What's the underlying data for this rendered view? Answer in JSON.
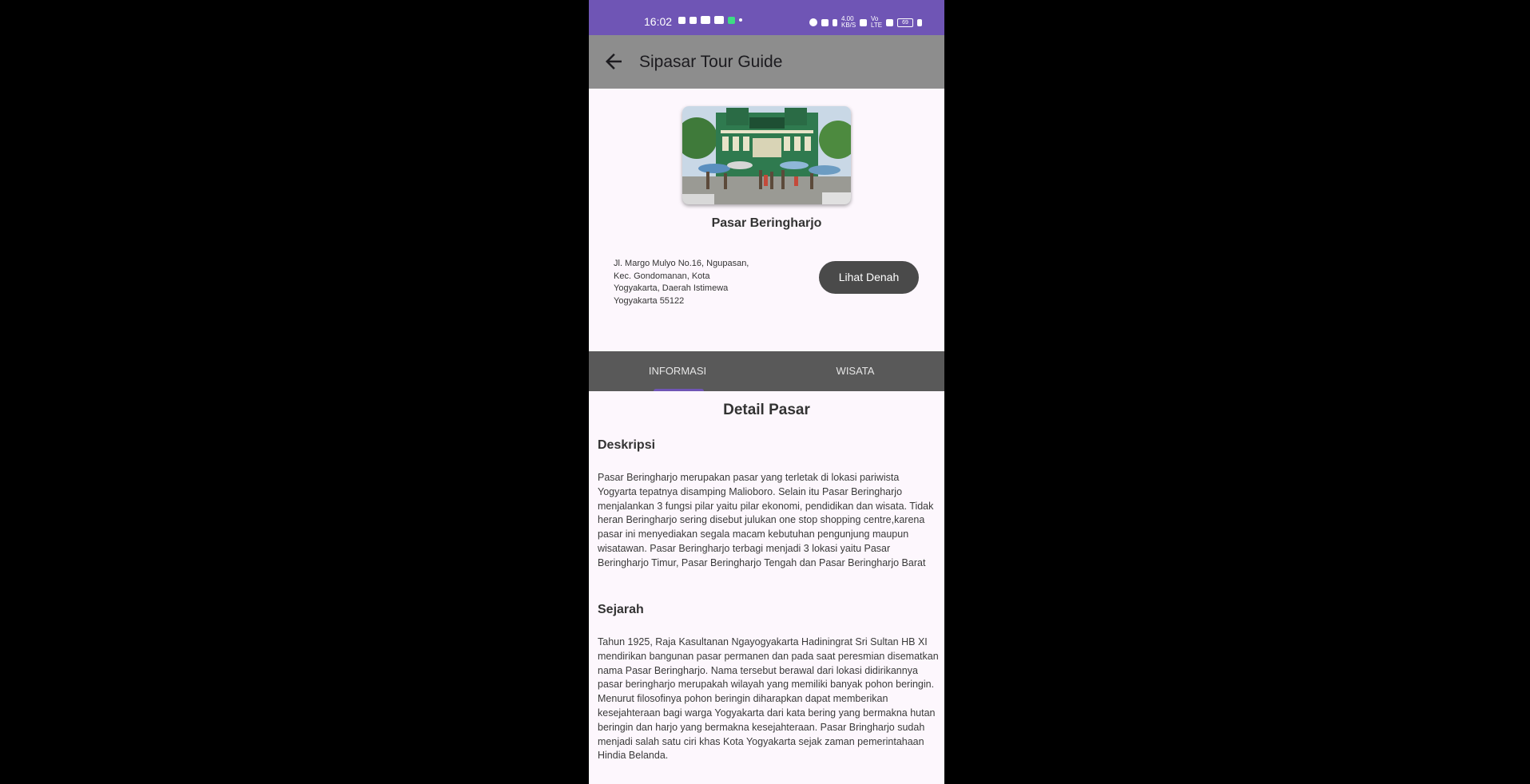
{
  "status_bar": {
    "time": "16:02",
    "network_speed": "4.00 KB/S",
    "network_type": "Vo LTE",
    "battery": "69"
  },
  "app_bar": {
    "title": "Sipasar Tour Guide",
    "back_icon": "arrow-back-icon"
  },
  "market": {
    "image_sign_text": "Pasar Beringharjo",
    "name": "Pasar Beringharjo",
    "address": "Jl. Margo Mulyo No.16, Ngupasan, Kec. Gondomanan, Kota Yogyakarta, Daerah Istimewa Yogyakarta 55122",
    "denah_button": "Lihat Denah"
  },
  "tabs": [
    {
      "label": "INFORMASI",
      "selected": true
    },
    {
      "label": "WISATA",
      "selected": false
    }
  ],
  "detail": {
    "title": "Detail Pasar",
    "sections": [
      {
        "heading": "Deskripsi",
        "body": "Pasar Beringharjo merupakan pasar yang terletak di lokasi pariwista Yogyarta tepatnya disamping Malioboro.  Selain itu Pasar Beringharjo menjalankan 3 fungsi pilar yaitu pilar ekonomi, pendidikan dan wisata. Tidak heran Beringharjo sering disebut julukan one stop shopping centre,karena pasar ini menyediakan segala macam kebutuhan pengunjung maupun wisatawan. Pasar Beringharjo terbagi menjadi 3 lokasi yaitu Pasar Beringharjo Timur, Pasar Beringharjo Tengah dan Pasar Beringharjo Barat"
      },
      {
        "heading": "Sejarah",
        "body": "Tahun 1925, Raja Kasultanan Ngayogyakarta Hadiningrat Sri Sultan HB XI mendirikan bangunan pasar permanen dan pada saat peresmian disematkan nama Pasar Beringharjo. Nama tersebut berawal dari lokasi didirikannya pasar beringharjo merupakah wilayah yang memiliki banyak pohon beringin. Menurut filosofinya pohon beringin diharapkan dapat memberikan kesejahteraan bagi warga Yogyakarta dari kata bering yang bermakna hutan beringin dan harjo yang bermakna kesejahteraan. Pasar Bringharjo sudah menjadi salah satu ciri khas Kota Yogyakarta sejak zaman pemerintahaan Hindia Belanda."
      }
    ]
  },
  "colors": {
    "status_bar": "#6f55b5",
    "app_bar": "#8d8d8d",
    "tab_bar": "#595959",
    "tab_indicator": "#6f55b5",
    "button": "#4a4a4a",
    "background": "#fdf7fd"
  }
}
